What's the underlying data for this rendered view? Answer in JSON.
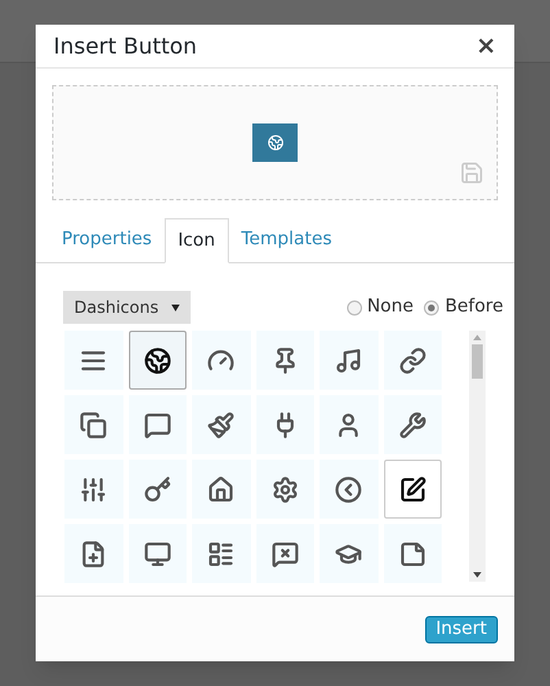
{
  "dialog": {
    "title": "Insert Button",
    "close": "×",
    "preview": {
      "kind": "icon-only"
    },
    "tabs": [
      {
        "label": "Properties",
        "selected": false
      },
      {
        "label": "Icon",
        "selected": true
      },
      {
        "label": "Templates",
        "selected": false
      }
    ],
    "icon_set": {
      "value": "Dashicons"
    },
    "position": [
      {
        "label": "None",
        "selected": false
      },
      {
        "label": "Before",
        "selected": true
      }
    ],
    "icons": [
      {
        "selected": false,
        "hovered": false
      },
      {
        "selected": true,
        "hovered": false
      },
      {
        "selected": false,
        "hovered": false
      },
      {
        "selected": false,
        "hovered": false
      },
      {
        "selected": false,
        "hovered": false
      },
      {
        "selected": false,
        "hovered": false
      },
      {
        "selected": false,
        "hovered": false
      },
      {
        "selected": false,
        "hovered": false
      },
      {
        "selected": false,
        "hovered": false
      },
      {
        "selected": false,
        "hovered": false
      },
      {
        "selected": false,
        "hovered": false
      },
      {
        "selected": false,
        "hovered": false
      },
      {
        "selected": false,
        "hovered": false
      },
      {
        "selected": false,
        "hovered": false
      },
      {
        "selected": false,
        "hovered": false
      },
      {
        "selected": false,
        "hovered": false
      },
      {
        "selected": false,
        "hovered": false
      },
      {
        "selected": false,
        "hovered": true
      },
      {
        "selected": false,
        "hovered": false
      },
      {
        "selected": false,
        "hovered": false
      },
      {
        "selected": false,
        "hovered": false
      },
      {
        "selected": false,
        "hovered": false
      },
      {
        "selected": false,
        "hovered": false
      },
      {
        "selected": false,
        "hovered": false
      }
    ],
    "insert_button": "Insert"
  }
}
